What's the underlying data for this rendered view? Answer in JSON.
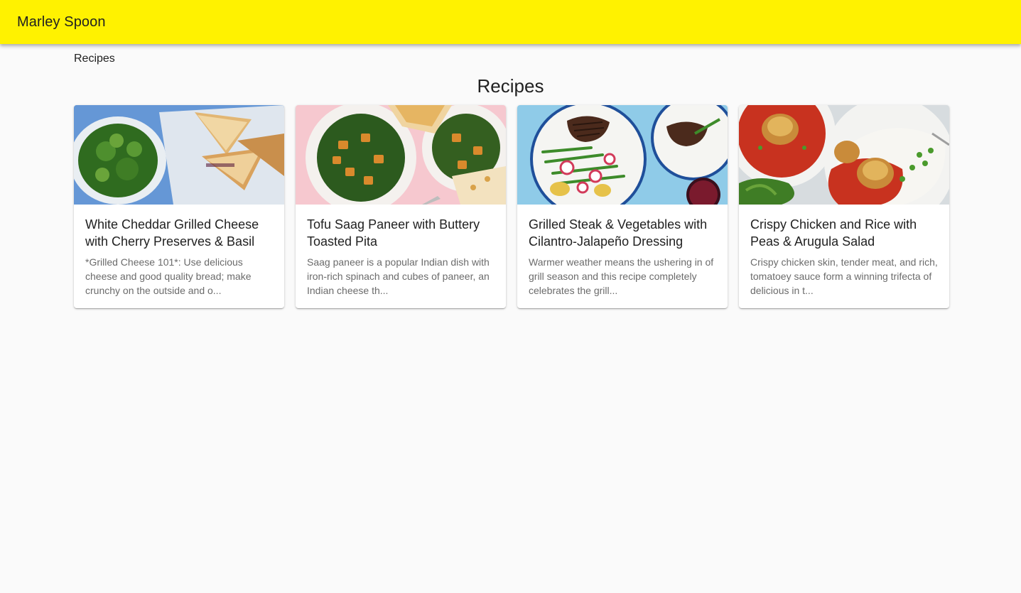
{
  "appbar": {
    "brand": "Marley Spoon",
    "color": "#fff200"
  },
  "breadcrumb": {
    "label": "Recipes"
  },
  "page": {
    "title": "Recipes"
  },
  "recipes": [
    {
      "title": "White Cheddar Grilled Cheese with Cherry Preserves & Basil",
      "description": "*Grilled Cheese 101*: Use delicious cheese and good quality bread; make crunchy on the outside and o...",
      "image": "grilled-cheese-photo"
    },
    {
      "title": "Tofu Saag Paneer with Buttery Toasted Pita",
      "description": "Saag paneer is a popular Indian dish with iron-rich spinach and cubes of paneer, an Indian cheese th...",
      "image": "saag-paneer-photo"
    },
    {
      "title": "Grilled Steak & Vegetables with Cilantro-Jalapeño Dressing",
      "description": "Warmer weather means the ushering in of grill season and this recipe completely celebrates the grill...",
      "image": "steak-vegetables-photo"
    },
    {
      "title": "Crispy Chicken and Rice with Peas & Arugula Salad",
      "description": "Crispy chicken skin, tender meat, and rich, tomatoey sauce form a winning trifecta of delicious in t...",
      "image": "crispy-chicken-photo"
    }
  ]
}
